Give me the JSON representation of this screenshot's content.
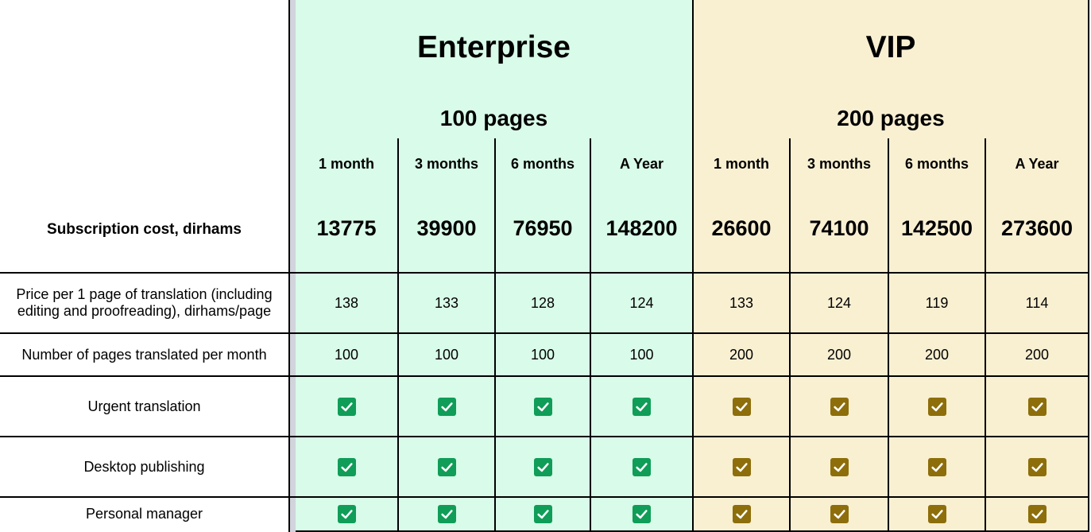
{
  "row_labels": {
    "cost": "Subscription cost, dirhams",
    "price": "Price per 1 page of translation (including editing and proofreading), dirhams/page",
    "pages": "Number of pages translated per month",
    "urgent": "Urgent translation",
    "dtp": "Desktop publishing",
    "manager": "Personal manager"
  },
  "plans": [
    {
      "name": "Enterprise",
      "pages_label": "100 pages",
      "bg_color": "#d9fbe9",
      "check_color": "#0f9d58",
      "columns": [
        {
          "period": "1 month",
          "cost": "13775",
          "price": "138",
          "pages": "100"
        },
        {
          "period": "3 months",
          "cost": "39900",
          "price": "133",
          "pages": "100"
        },
        {
          "period": "6 months",
          "cost": "76950",
          "price": "128",
          "pages": "100"
        },
        {
          "period": "A Year",
          "cost": "148200",
          "price": "124",
          "pages": "100"
        }
      ]
    },
    {
      "name": "VIP",
      "pages_label": "200 pages",
      "bg_color": "#f9f0d2",
      "check_color": "#8d6e0a",
      "columns": [
        {
          "period": "1 month",
          "cost": "26600",
          "price": "133",
          "pages": "200"
        },
        {
          "period": "3 months",
          "cost": "74100",
          "price": "124",
          "pages": "200"
        },
        {
          "period": "6 months",
          "cost": "142500",
          "price": "119",
          "pages": "200"
        },
        {
          "period": "A Year",
          "cost": "273600",
          "price": "114",
          "pages": "200"
        }
      ]
    }
  ],
  "checkbox_icon": "checked-checkbox-icon"
}
